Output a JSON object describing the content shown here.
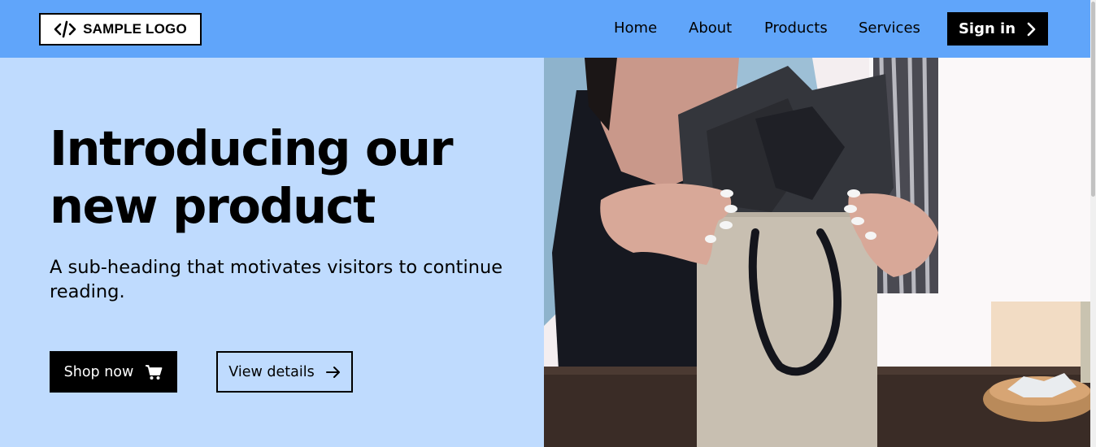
{
  "header": {
    "logo_text": "SAMPLE LOGO",
    "nav": [
      {
        "label": "Home"
      },
      {
        "label": "About"
      },
      {
        "label": "Products"
      },
      {
        "label": "Services"
      }
    ],
    "signin_label": "Sign in"
  },
  "hero": {
    "title_line1": "Introducing our",
    "title_line2": "new product",
    "subheading_line1": "A sub-heading that motivates visitors to continue",
    "subheading_line2": "reading.",
    "primary_button": "Shop now",
    "secondary_button": "View details"
  },
  "colors": {
    "header_bg": "#60a5fa",
    "hero_bg": "#bfdbfe",
    "button_dark": "#000000"
  },
  "icons": [
    "code-icon",
    "chevron-right-icon",
    "cart-icon",
    "arrow-right-icon"
  ]
}
